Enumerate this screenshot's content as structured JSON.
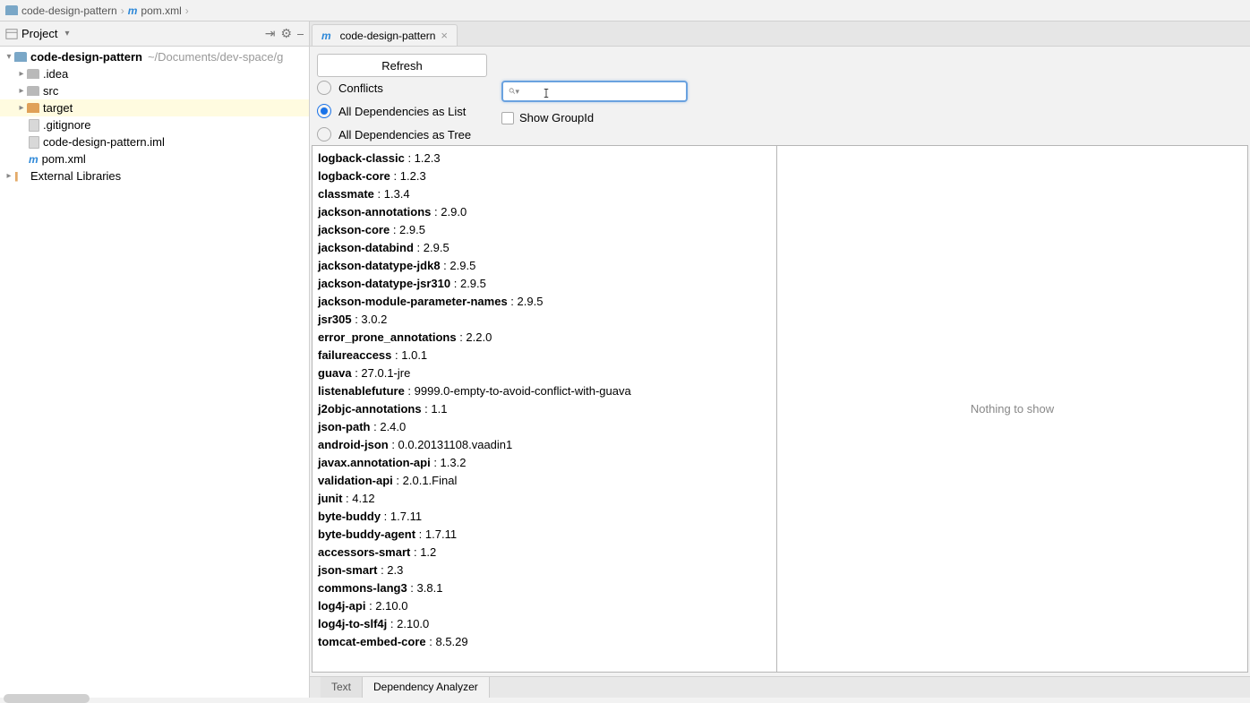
{
  "breadcrumb": {
    "root": "code-design-pattern",
    "file": "pom.xml"
  },
  "project_panel": {
    "title": "Project",
    "tree": {
      "root": {
        "label": "code-design-pattern",
        "path": "~/Documents/dev-space/g"
      },
      "children": [
        {
          "label": ".idea",
          "type": "folder-gray"
        },
        {
          "label": "src",
          "type": "folder-gray"
        },
        {
          "label": "target",
          "type": "folder-orange",
          "selected": true
        },
        {
          "label": ".gitignore",
          "type": "file"
        },
        {
          "label": "code-design-pattern.iml",
          "type": "file"
        },
        {
          "label": "pom.xml",
          "type": "maven"
        }
      ],
      "external_libraries": "External Libraries"
    }
  },
  "editor": {
    "tab_label": "code-design-pattern"
  },
  "analyzer": {
    "refresh_label": "Refresh",
    "radios": {
      "conflicts": "Conflicts",
      "as_list": "All Dependencies as List",
      "as_tree": "All Dependencies as Tree"
    },
    "selected_radio": "as_list",
    "show_groupid_label": "Show GroupId",
    "search_value": "",
    "detail_placeholder": "Nothing to show",
    "dependencies": [
      {
        "artifact": "logback-classic",
        "version": "1.2.3"
      },
      {
        "artifact": "logback-core",
        "version": "1.2.3"
      },
      {
        "artifact": "classmate",
        "version": "1.3.4"
      },
      {
        "artifact": "jackson-annotations",
        "version": "2.9.0"
      },
      {
        "artifact": "jackson-core",
        "version": "2.9.5"
      },
      {
        "artifact": "jackson-databind",
        "version": "2.9.5"
      },
      {
        "artifact": "jackson-datatype-jdk8",
        "version": "2.9.5"
      },
      {
        "artifact": "jackson-datatype-jsr310",
        "version": "2.9.5"
      },
      {
        "artifact": "jackson-module-parameter-names",
        "version": "2.9.5"
      },
      {
        "artifact": "jsr305",
        "version": "3.0.2"
      },
      {
        "artifact": "error_prone_annotations",
        "version": "2.2.0"
      },
      {
        "artifact": "failureaccess",
        "version": "1.0.1"
      },
      {
        "artifact": "guava",
        "version": "27.0.1-jre"
      },
      {
        "artifact": "listenablefuture",
        "version": "9999.0-empty-to-avoid-conflict-with-guava"
      },
      {
        "artifact": "j2objc-annotations",
        "version": "1.1"
      },
      {
        "artifact": "json-path",
        "version": "2.4.0"
      },
      {
        "artifact": "android-json",
        "version": "0.0.20131108.vaadin1"
      },
      {
        "artifact": "javax.annotation-api",
        "version": "1.3.2"
      },
      {
        "artifact": "validation-api",
        "version": "2.0.1.Final"
      },
      {
        "artifact": "junit",
        "version": "4.12"
      },
      {
        "artifact": "byte-buddy",
        "version": "1.7.11"
      },
      {
        "artifact": "byte-buddy-agent",
        "version": "1.7.11"
      },
      {
        "artifact": "accessors-smart",
        "version": "1.2"
      },
      {
        "artifact": "json-smart",
        "version": "2.3"
      },
      {
        "artifact": "commons-lang3",
        "version": "3.8.1"
      },
      {
        "artifact": "log4j-api",
        "version": "2.10.0"
      },
      {
        "artifact": "log4j-to-slf4j",
        "version": "2.10.0"
      },
      {
        "artifact": "tomcat-embed-core",
        "version": "8.5.29"
      }
    ]
  },
  "bottom_tabs": {
    "text": "Text",
    "dep_analyzer": "Dependency Analyzer"
  }
}
